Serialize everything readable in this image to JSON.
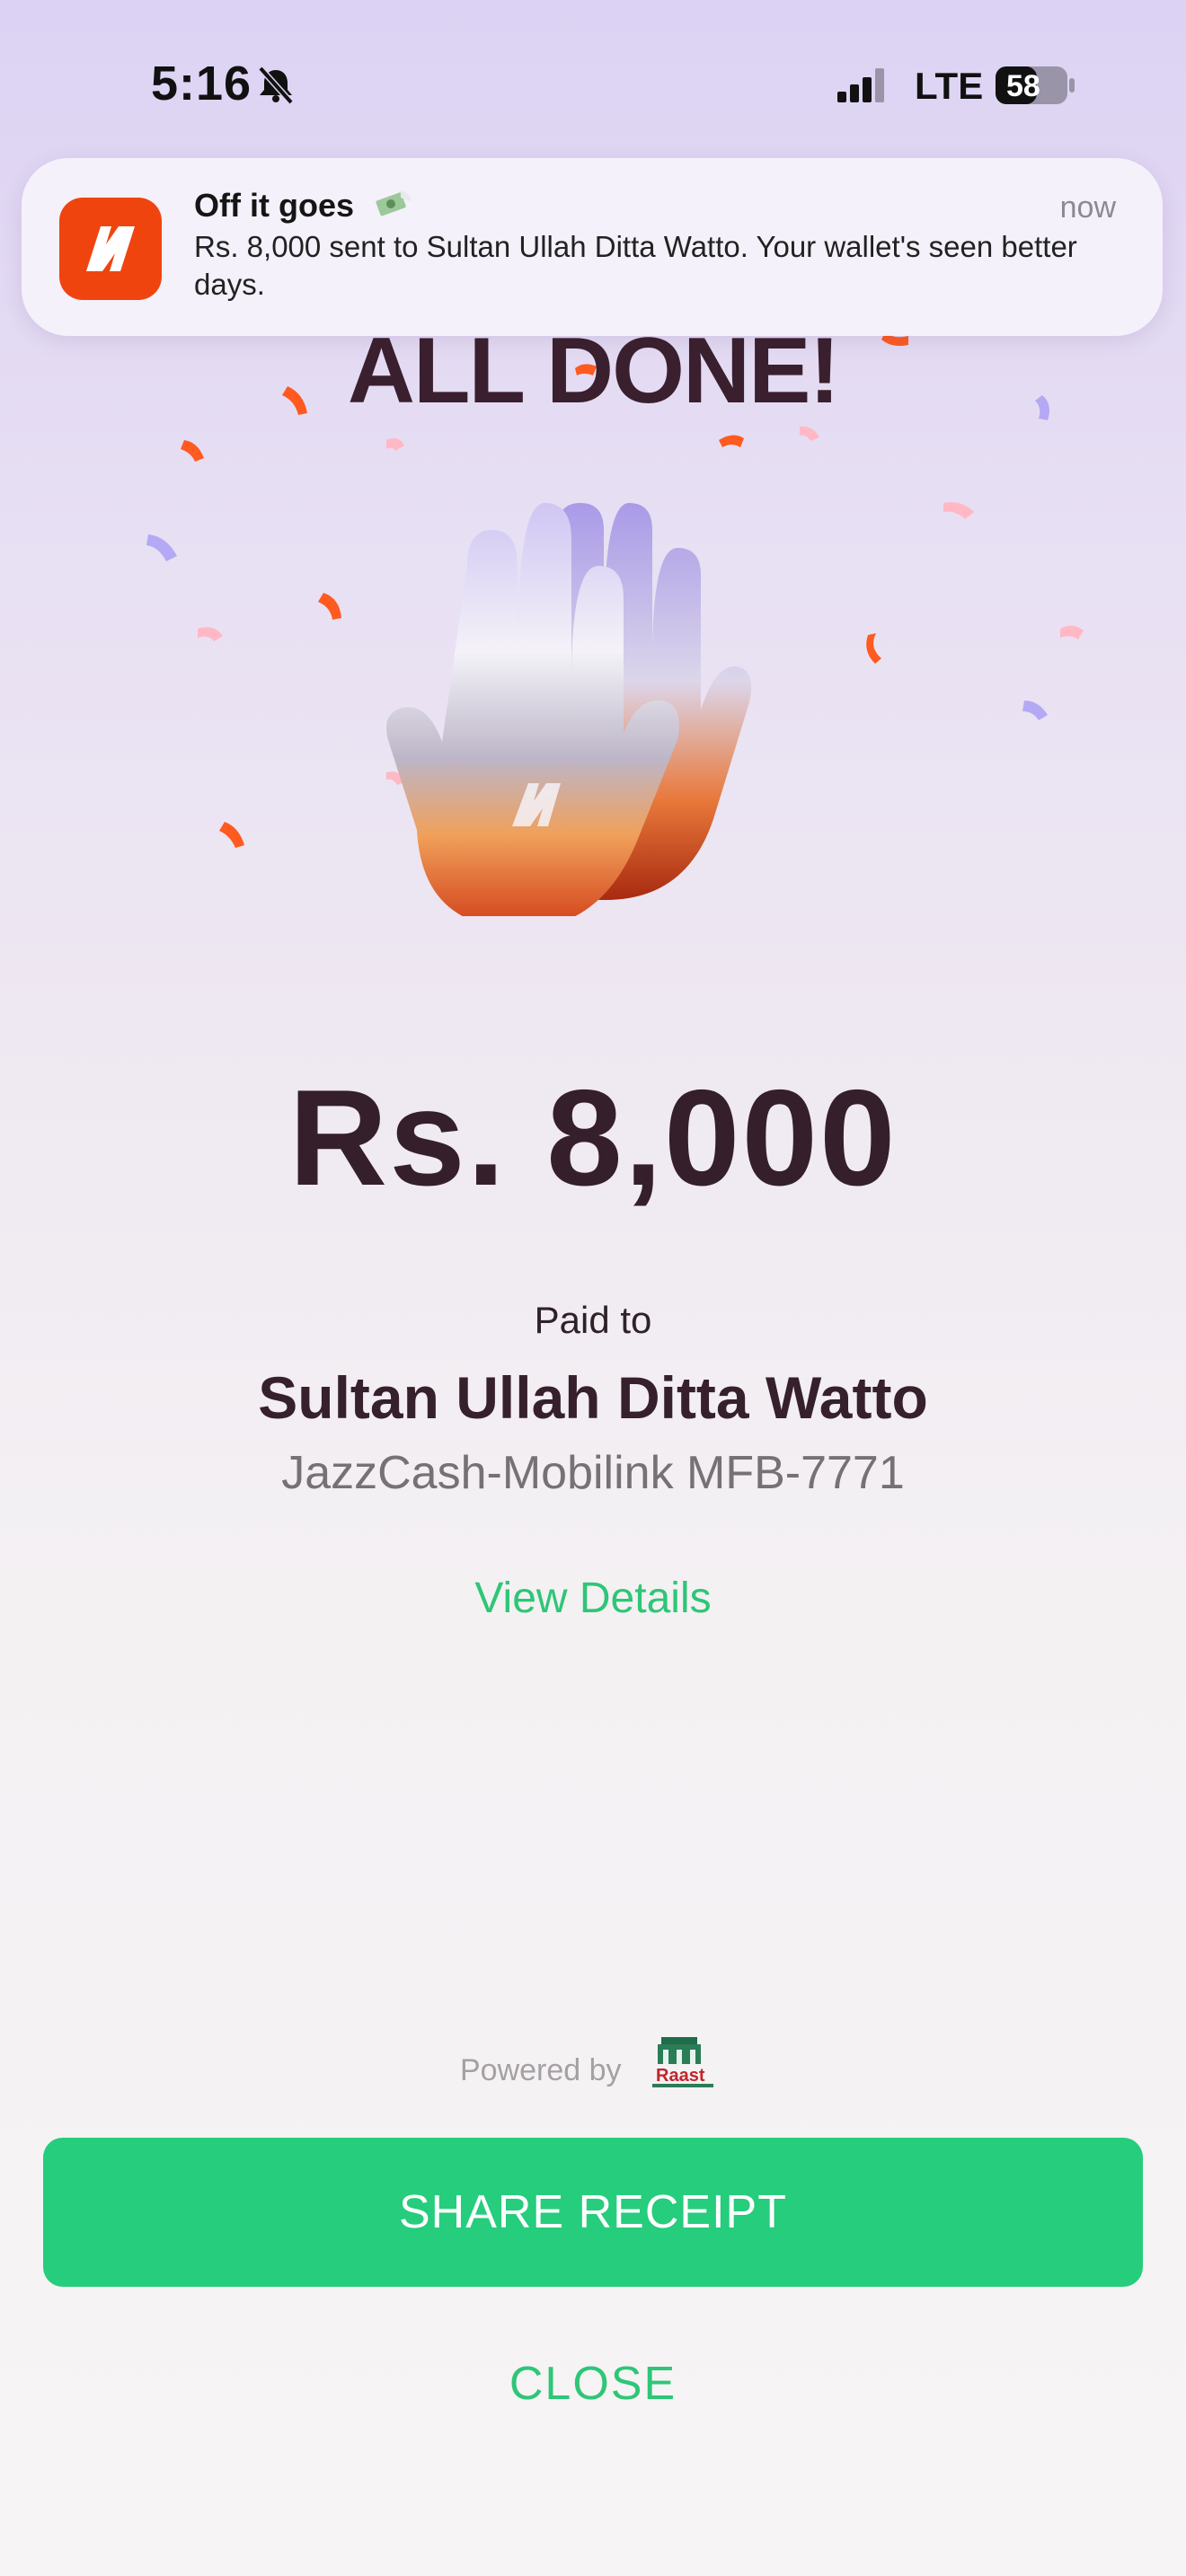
{
  "status_bar": {
    "time": "5:16",
    "network": "LTE",
    "battery": "58"
  },
  "notification": {
    "title": "Off it goes",
    "emoji_icon": "money-with-wings-icon",
    "body": "Rs. 8,000 sent to Sultan Ullah Ditta Watto. Your wallet's seen better days.",
    "time": "now"
  },
  "hero": {
    "title": "ALL DONE!"
  },
  "payment": {
    "amount": "Rs. 8,000",
    "paid_to_label": "Paid to",
    "payee_name": "Sultan Ullah Ditta Watto",
    "payee_account": "JazzCash-Mobilink MFB-7771",
    "view_details": "View Details"
  },
  "footer": {
    "powered_by": "Powered by",
    "raast_logo_text": "Raast",
    "share_receipt": "SHARE RECEIPT",
    "close": "CLOSE"
  },
  "colors": {
    "accent_green": "#25cd7c",
    "brand_orange": "#f0440f",
    "dark_text": "#35202b"
  }
}
